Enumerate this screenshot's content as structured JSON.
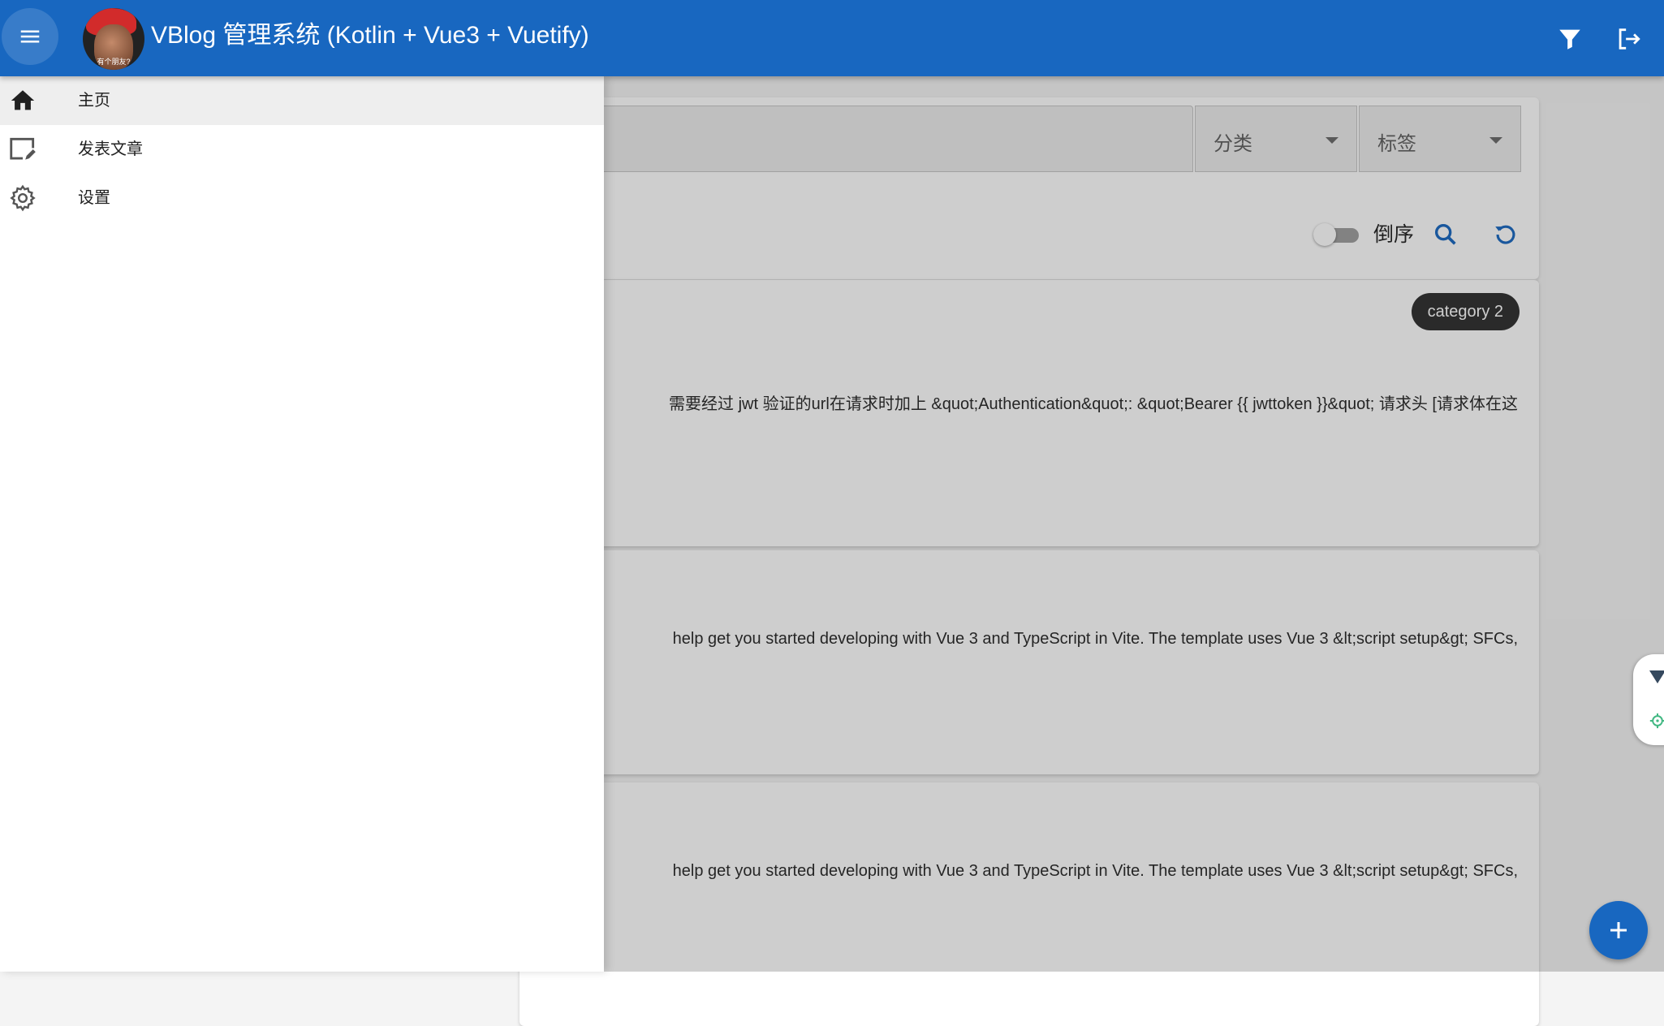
{
  "appbar": {
    "title": "VBlog 管理系统 (Kotlin + Vue3 + Vuetify)",
    "avatar_caption": "有个朋友?",
    "icons": {
      "menu": "menu-icon",
      "filter": "filter-icon",
      "logout": "logout-icon"
    }
  },
  "drawer": {
    "items": [
      {
        "label": "主页",
        "icon": "home-icon",
        "active": true
      },
      {
        "label": "发表文章",
        "icon": "edit-post-icon",
        "active": false
      },
      {
        "label": "设置",
        "icon": "gear-icon",
        "active": false
      }
    ]
  },
  "filter": {
    "category_label": "分类",
    "tag_label": "标签",
    "toggle_label": "倒序",
    "toggle_on": false
  },
  "posts": [
    {
      "category": "category 2",
      "excerpt": "需要经过 jwt 验证的url在请求时加上 &quot;Authentication&quot;: &quot;Bearer {{ jwttoken }}&quot; 请求头 [请求体在这"
    },
    {
      "category": "",
      "excerpt": "help get you started developing with Vue 3 and TypeScript in Vite. The template uses Vue 3 &lt;script setup&gt; SFCs,"
    },
    {
      "category": "",
      "excerpt": "help get you started developing with Vue 3 and TypeScript in Vite. The template uses Vue 3 &lt;script setup&gt; SFCs,"
    }
  ],
  "colors": {
    "primary": "#1867c0",
    "chip": "#2e2e2e"
  }
}
